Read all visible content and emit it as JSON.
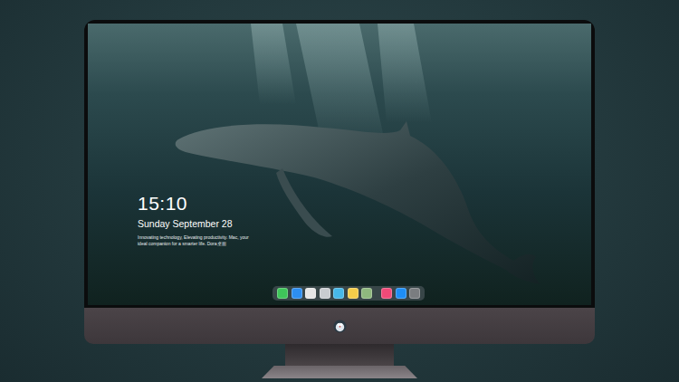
{
  "desktop": {
    "clock": {
      "time": "15:10",
      "date": "Sunday September 28"
    },
    "tagline": "Innovating technology, Elevating productivity. Mac, your ideal companion for a smarter life. Dora桌面"
  },
  "dock": {
    "groups": [
      [
        {
          "name": "messages",
          "color": "#3fc55a"
        },
        {
          "name": "mail",
          "color": "#2d8ef0"
        },
        {
          "name": "safari",
          "color": "#e6e6e6"
        },
        {
          "name": "preview",
          "color": "#c9ccd0"
        },
        {
          "name": "clips",
          "color": "#47b8e8"
        },
        {
          "name": "notes",
          "color": "#f4cd4a"
        },
        {
          "name": "photos",
          "color": "#8fb87e"
        }
      ],
      [
        {
          "name": "music",
          "color": "#f04a78"
        },
        {
          "name": "app-store",
          "color": "#1e8ef5"
        },
        {
          "name": "system",
          "color": "#7a7d80"
        }
      ]
    ]
  }
}
